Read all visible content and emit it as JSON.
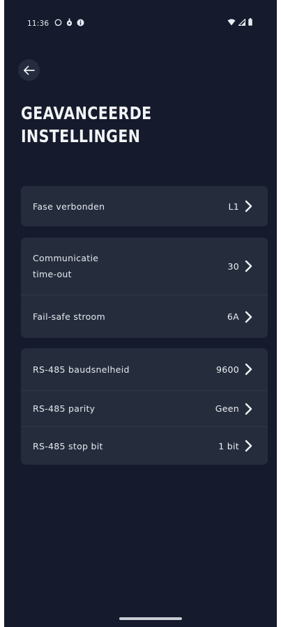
{
  "status_bar": {
    "time": "11:36",
    "left_icons": [
      "whatsapp-icon",
      "usb-debug-icon",
      "info-icon"
    ],
    "right_icons": [
      "wifi-icon",
      "signal-icon",
      "battery-icon"
    ]
  },
  "header": {
    "back_icon": "arrow-left-icon",
    "title": "GEAVANCEERDE INSTELLINGEN"
  },
  "groups": [
    {
      "rows": [
        {
          "label": "Fase verbonden",
          "value": "L1"
        }
      ]
    },
    {
      "rows": [
        {
          "label": "Communicatie time-out",
          "value": "30"
        },
        {
          "label": "Fail-safe stroom",
          "value": "6A"
        }
      ]
    },
    {
      "rows": [
        {
          "label": "RS-485 baudsnelheid",
          "value": "9600"
        },
        {
          "label": "RS-485 parity",
          "value": "Geen"
        },
        {
          "label": "RS-485 stop bit",
          "value": "1 bit"
        }
      ]
    }
  ],
  "colors": {
    "background": "#151b2c",
    "card": "#252d3d",
    "text": "#e6e9ef"
  }
}
